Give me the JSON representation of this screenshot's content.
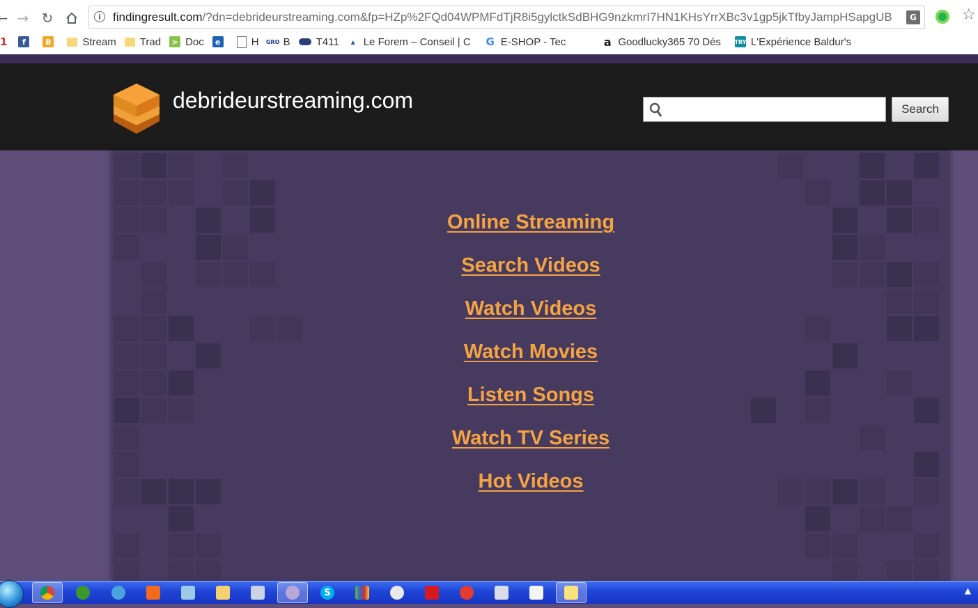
{
  "browser": {
    "url_host": "findingresult.com",
    "url_rest": "/?dn=debrideurstreaming.com&fp=HZp%2FQd04WPMFdTjR8i5gylctkSdBHG9nzkmrI7HN1KHsYrrXBc3v1gp5jkTfbyJampHSapgUB",
    "bookmarks": [
      {
        "label": "",
        "icon": "facebook-icon"
      },
      {
        "label": "",
        "icon": "b-icon"
      },
      {
        "label": "Stream",
        "icon": "folder-icon"
      },
      {
        "label": "Trad",
        "icon": "folder-icon"
      },
      {
        "label": "Doc",
        "icon": "doc-icon"
      },
      {
        "label": "",
        "icon": "app-icon"
      },
      {
        "label": "H",
        "icon": "page-icon"
      },
      {
        "label": "B",
        "icon": "gro-icon"
      },
      {
        "label": "T411",
        "icon": "t411-icon"
      },
      {
        "label": "Le Forem – Conseil | C",
        "icon": "forem-icon"
      },
      {
        "label": "E-SHOP - Tec",
        "icon": "google-icon"
      },
      {
        "label": "Goodlucky365 70 Dés",
        "icon": "amazon-icon"
      },
      {
        "label": "L'Expérience Baldur's",
        "icon": "baldur-icon"
      }
    ]
  },
  "site": {
    "title": "debrideurstreaming.com",
    "search_button": "Search",
    "search_value": "",
    "links": [
      "Online Streaming",
      "Search Videos",
      "Watch Videos",
      "Watch Movies",
      "Listen Songs",
      "Watch TV Series",
      "Hot Videos"
    ],
    "colors": {
      "link": "#f6a441",
      "header_bg": "#1c1c1c",
      "panel_bg": "#463a5e",
      "page_bg": "#5d4d78"
    }
  },
  "taskbar": {
    "apps": [
      "chrome-icon",
      "utorrent-icon",
      "thunderbird-icon",
      "app-orange-icon",
      "notes-icon",
      "explorer-icon",
      "printer-icon",
      "media-icon",
      "skype-icon",
      "library-icon",
      "tool-icon",
      "avira-icon",
      "game-icon",
      "network-icon",
      "notepad-icon",
      "mail-icon"
    ]
  }
}
